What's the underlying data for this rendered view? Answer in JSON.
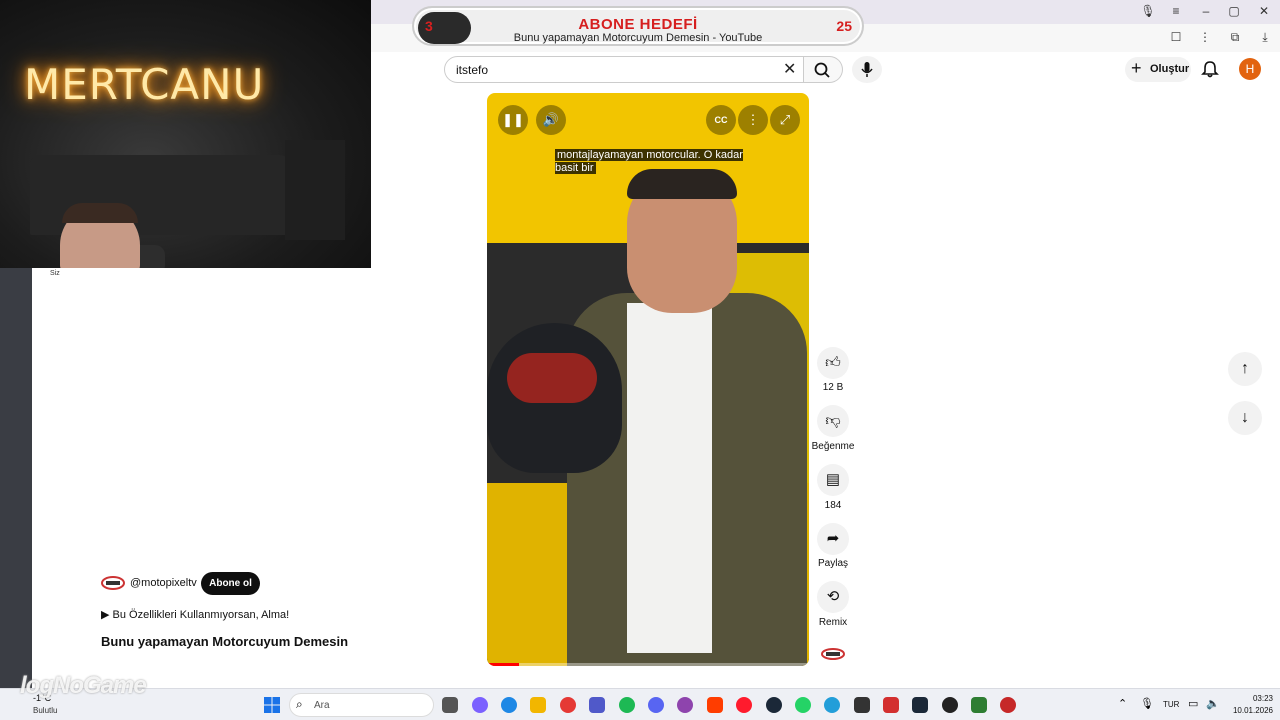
{
  "overlay": {
    "streamer_name": "MERTCANU",
    "cam_label": "Siz",
    "goal_title": "ABONE HEDEFİ",
    "goal_current": "3",
    "goal_target": "25",
    "tab_title": "Bunu yapamayan Motorcuyum Demesin - YouTube",
    "watermark": "logNoGame"
  },
  "header": {
    "search_value": "itstefo",
    "create_label": "Oluştur",
    "avatar_letter": "H"
  },
  "video": {
    "caption": "montajlayamayan motorcular. O kadar basit bir",
    "progress": 0.1
  },
  "actions": {
    "likes": "12 B",
    "dislike": "Beğenme",
    "comments": "184",
    "share": "Paylaş",
    "remix": "Remix"
  },
  "channel": {
    "handle": "@motopixeltv",
    "subscribe": "Abone ol",
    "related": "▶ Bu Özellikleri Kullanmıyorsan, Alma!",
    "title": "Bunu yapamayan Motorcuyum Demesin"
  },
  "taskbar": {
    "temp": "-1°C",
    "weather": "Bulutlu",
    "search_placeholder": "Ara",
    "lang": "TUR",
    "time": "03:23",
    "date": "10.01.2026"
  },
  "colors": {
    "accent_red": "#d61f1f",
    "video_yellow": "#f2c500",
    "subscribe_bg": "#0f0f0f"
  }
}
